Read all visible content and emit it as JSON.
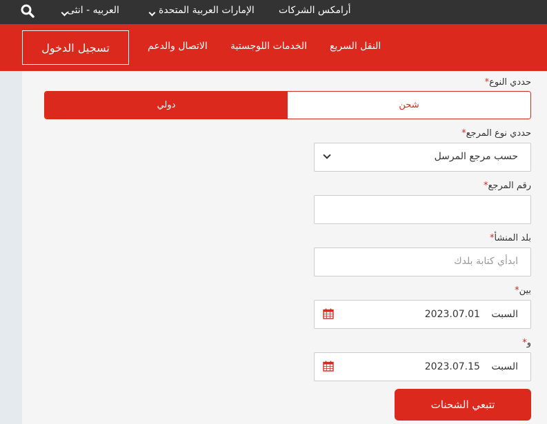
{
  "topbar": {
    "companies": "أرامكس الشركات",
    "country": "الإمارات العربية المتحدة",
    "language": "العربيه - انثى"
  },
  "nav": {
    "express": "النقل السريع",
    "logistics": "الخدمات اللوجستية",
    "contact": "الاتصال والدعم",
    "login": "تسجيل الدخول"
  },
  "form": {
    "type_label": "حددي النوع",
    "type_options": [
      "شحن",
      "دولي"
    ],
    "type_selected": "دولي",
    "ref_type_label": "حددي نوع المرجع",
    "ref_type_value": "حسب مرجع المرسل",
    "ref_number_label": "رقم المرجع",
    "ref_number_value": "",
    "origin_label": "بلد المنشأ",
    "origin_placeholder": "ابدأي كتابة بلدك",
    "between_label": "بين",
    "from_day": "السبت",
    "from_date": "2023.07.01",
    "and_label": "و",
    "to_day": "السبت",
    "to_date": "2023.07.15",
    "required_mark": "*",
    "submit": "تتبعي الشحنات"
  },
  "colors": {
    "brand_red": "#dc291e",
    "topbar_dark": "#333333"
  },
  "icons": {
    "search": "search-icon",
    "calendar": "calendar-icon",
    "chevron": "chevron-down-icon"
  }
}
